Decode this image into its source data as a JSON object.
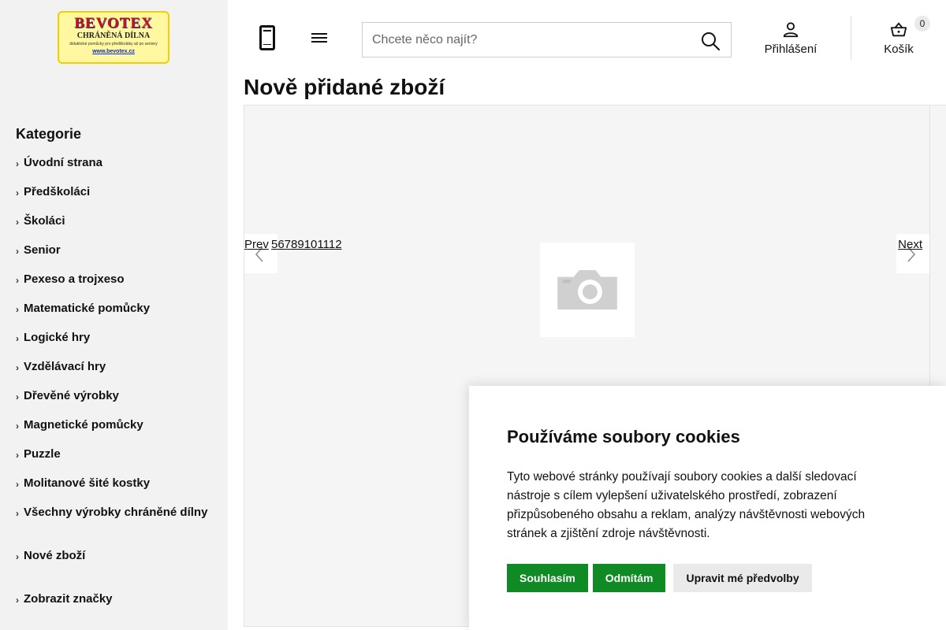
{
  "logo": {
    "line1": "BEVOTEX",
    "line2": "CHRÁNĚNÁ DÍLNA",
    "line3": "didaktické pomůcky pro předškoláky až po seniory",
    "line4": "www.bevotex.cz"
  },
  "sidebar": {
    "title": "Kategorie",
    "items": [
      {
        "label": "Úvodní strana"
      },
      {
        "label": "Předškoláci"
      },
      {
        "label": "Školáci"
      },
      {
        "label": "Senior"
      },
      {
        "label": "Pexeso a trojxeso"
      },
      {
        "label": "Matematické pomůcky"
      },
      {
        "label": "Logické hry"
      },
      {
        "label": "Vzdělávací hry"
      },
      {
        "label": "Dřevěné výrobky"
      },
      {
        "label": "Magnetické pomůcky"
      },
      {
        "label": "Puzzle"
      },
      {
        "label": "Molitanové šité kostky"
      },
      {
        "label": "Všechny výrobky chráněné dílny"
      },
      {
        "label": "Nové zboží"
      },
      {
        "label": "Zobrazit značky"
      }
    ]
  },
  "header": {
    "search_placeholder": "Chcete něco najít?",
    "login_label": "Přihlášení",
    "cart_label": "Košík",
    "cart_count": "0"
  },
  "main": {
    "title": "Nově přidané zboží",
    "carousel": {
      "prev_label": "Prev",
      "pager": "56789101112",
      "next_label": "Next"
    }
  },
  "cookie": {
    "title": "Používáme soubory cookies",
    "text": "Tyto webové stránky používají soubory cookies a další sledovací nástroje s cílem vylepšení uživatelského prostředí, zobrazení přizpůsobeného obsahu a reklam, analýzy návštěvnosti webových stránek a zjištění zdroje návštěvnosti.",
    "accept_label": "Souhlasím",
    "reject_label": "Odmítám",
    "prefs_label": "Upravit mé předvolby"
  },
  "colors": {
    "accent_green": "#0f8a24",
    "sidebar_bg": "#f2f2f2"
  }
}
